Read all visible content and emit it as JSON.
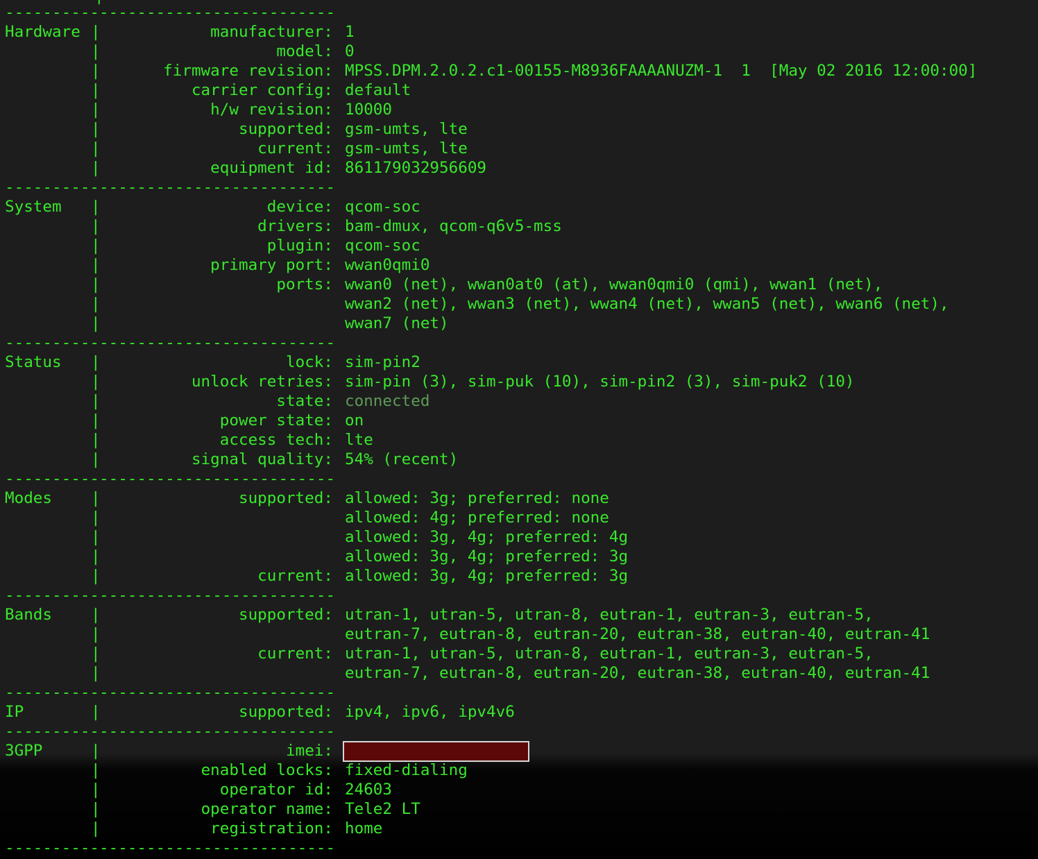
{
  "separator": "-----------------------------------",
  "pipe": "|",
  "sections": [
    {
      "name": "Hardware",
      "rows": [
        {
          "key": "manufacturer:",
          "value": "1"
        },
        {
          "key": "model:",
          "value": "0"
        },
        {
          "key": "firmware revision:",
          "value": "MPSS.DPM.2.0.2.c1-00155-M8936FAAAANUZM-1  1  [May 02 2016 12:00:00]"
        },
        {
          "key": "carrier config:",
          "value": "default"
        },
        {
          "key": "h/w revision:",
          "value": "10000"
        },
        {
          "key": "supported:",
          "value": "gsm-umts, lte"
        },
        {
          "key": "current:",
          "value": "gsm-umts, lte"
        },
        {
          "key": "equipment id:",
          "value": "861179032956609"
        }
      ]
    },
    {
      "name": "System",
      "rows": [
        {
          "key": "device:",
          "value": "qcom-soc"
        },
        {
          "key": "drivers:",
          "value": "bam-dmux, qcom-q6v5-mss"
        },
        {
          "key": "plugin:",
          "value": "qcom-soc"
        },
        {
          "key": "primary port:",
          "value": "wwan0qmi0"
        },
        {
          "key": "ports:",
          "value": "wwan0 (net), wwan0at0 (at), wwan0qmi0 (qmi), wwan1 (net),"
        },
        {
          "key": "",
          "value": "wwan2 (net), wwan3 (net), wwan4 (net), wwan5 (net), wwan6 (net),"
        },
        {
          "key": "",
          "value": "wwan7 (net)"
        }
      ]
    },
    {
      "name": "Status",
      "rows": [
        {
          "key": "lock:",
          "value": "sim-pin2"
        },
        {
          "key": "unlock retries:",
          "value": "sim-pin (3), sim-puk (10), sim-pin2 (3), sim-puk2 (10)"
        },
        {
          "key": "state:",
          "value": "connected",
          "dim": true
        },
        {
          "key": "power state:",
          "value": "on"
        },
        {
          "key": "access tech:",
          "value": "lte"
        },
        {
          "key": "signal quality:",
          "value": "54% (recent)"
        }
      ]
    },
    {
      "name": "Modes",
      "rows": [
        {
          "key": "supported:",
          "value": "allowed: 3g; preferred: none"
        },
        {
          "key": "",
          "value": "allowed: 4g; preferred: none"
        },
        {
          "key": "",
          "value": "allowed: 3g, 4g; preferred: 4g"
        },
        {
          "key": "",
          "value": "allowed: 3g, 4g; preferred: 3g"
        },
        {
          "key": "current:",
          "value": "allowed: 3g, 4g; preferred: 3g"
        }
      ]
    },
    {
      "name": "Bands",
      "rows": [
        {
          "key": "supported:",
          "value": "utran-1, utran-5, utran-8, eutran-1, eutran-3, eutran-5,"
        },
        {
          "key": "",
          "value": "eutran-7, eutran-8, eutran-20, eutran-38, eutran-40, eutran-41"
        },
        {
          "key": "current:",
          "value": "utran-1, utran-5, utran-8, eutran-1, eutran-3, eutran-5,"
        },
        {
          "key": "",
          "value": "eutran-7, eutran-8, eutran-20, eutran-38, eutran-40, eutran-41"
        }
      ]
    },
    {
      "name": "IP",
      "rows": [
        {
          "key": "supported:",
          "value": "ipv4, ipv6, ipv4v6"
        }
      ]
    },
    {
      "name": "3GPP",
      "rows": [
        {
          "key": "imei:",
          "value": "",
          "redacted": true
        },
        {
          "key": "enabled locks:",
          "value": "fixed-dialing"
        },
        {
          "key": "operator id:",
          "value": "24603"
        },
        {
          "key": "operator name:",
          "value": "Tele2 LT"
        },
        {
          "key": "registration:",
          "value": "home"
        }
      ]
    }
  ]
}
